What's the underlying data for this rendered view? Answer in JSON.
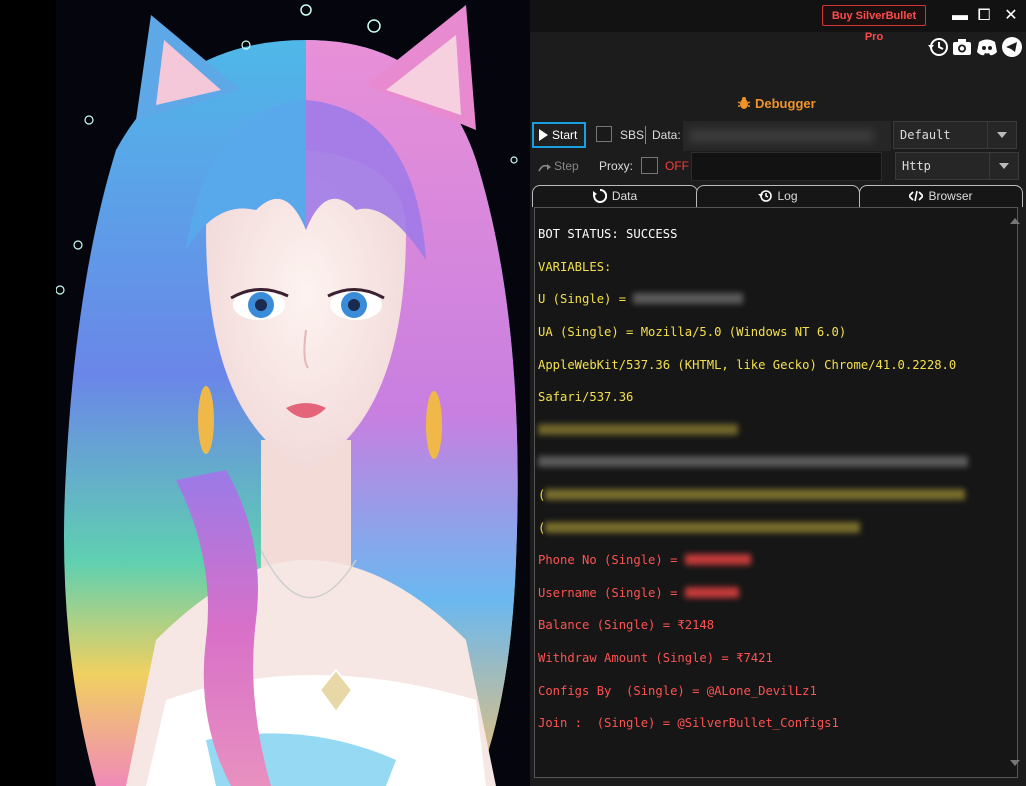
{
  "titlebar": {
    "buy_label": "Buy SilverBullet Pro",
    "minimize_glyph": "▬",
    "maximize_glyph": "⧠",
    "close_glyph": "✕"
  },
  "toolbar_icons": [
    "history-icon",
    "camera-icon",
    "discord-icon",
    "telegram-icon"
  ],
  "debugger": {
    "title": "Debugger"
  },
  "controls": {
    "start_label": "Start",
    "sbs_label": "SBS",
    "data_label": "Data:",
    "select_default": "Default",
    "step_label": "Step",
    "proxy_label": "Proxy:",
    "proxy_state": "OFF",
    "select_proxy_type": "Http"
  },
  "tabs": [
    {
      "label": "Data",
      "icon": "refresh-icon"
    },
    {
      "label": "Log",
      "icon": "history-icon"
    },
    {
      "label": "Browser",
      "icon": "code-icon"
    }
  ],
  "output": {
    "bot_status": "BOT STATUS: SUCCESS",
    "variables": "VARIABLES:",
    "u_single": "U (Single) = ",
    "ua_line1": "UA (Single) = Mozilla/5.0 (Windows NT 6.0)",
    "ua_line2": "AppleWebKit/537.36 (KHTML, like Gecko) Chrome/41.0.2228.0",
    "ua_line3": "Safari/537.36",
    "open_paren_1": "(",
    "open_paren_2": "(",
    "phone": "Phone No (Single) = ",
    "username": "Username (Single) = ",
    "balance": "Balance (Single) = ₹2148",
    "withdraw": "Withdraw Amount (Single) = ₹7421",
    "configs_by": "Configs By  (Single) = @ALone_DevilLz1",
    "join": "Join :  (Single) = @SilverBullet_Configs1"
  },
  "colors": {
    "accent_blue": "#1aa0e0",
    "debugger_orange": "#f0942a",
    "status_white": "#ffffff",
    "vars_yellow": "#f3e04c",
    "captures_red": "#ff5252",
    "buy_red": "#d43535"
  }
}
